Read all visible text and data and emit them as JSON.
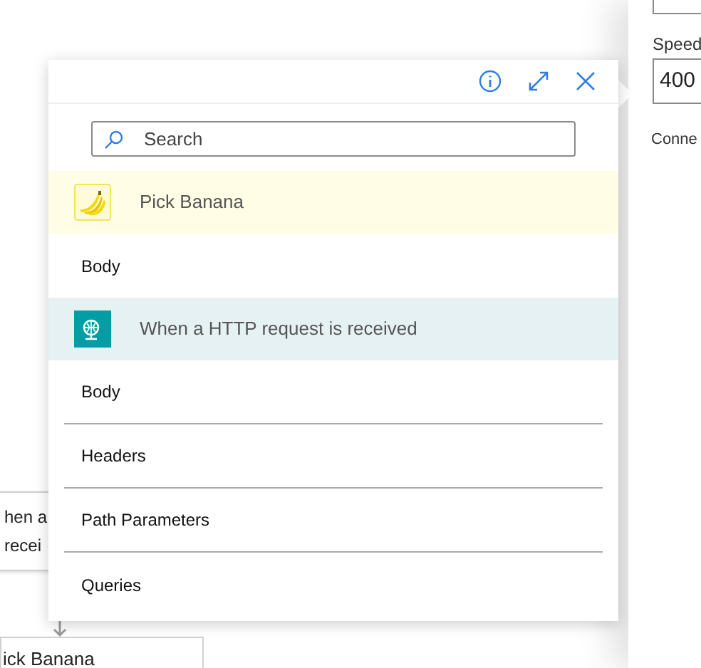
{
  "canvas": {
    "trigger_card": [
      "hen a",
      "recei"
    ],
    "action_card": "ick Banana"
  },
  "side_panel": {
    "field_label": "Speed",
    "field_value": "400",
    "section_label": "Conne"
  },
  "popup": {
    "search": {
      "placeholder": "Search"
    },
    "groups": [
      {
        "kind": "banana",
        "title": "Pick Banana",
        "items": [
          "Body"
        ]
      },
      {
        "kind": "http",
        "title": "When a HTTP request is received",
        "items": [
          "Body",
          "Headers",
          "Path Parameters",
          "Queries"
        ]
      }
    ]
  }
}
